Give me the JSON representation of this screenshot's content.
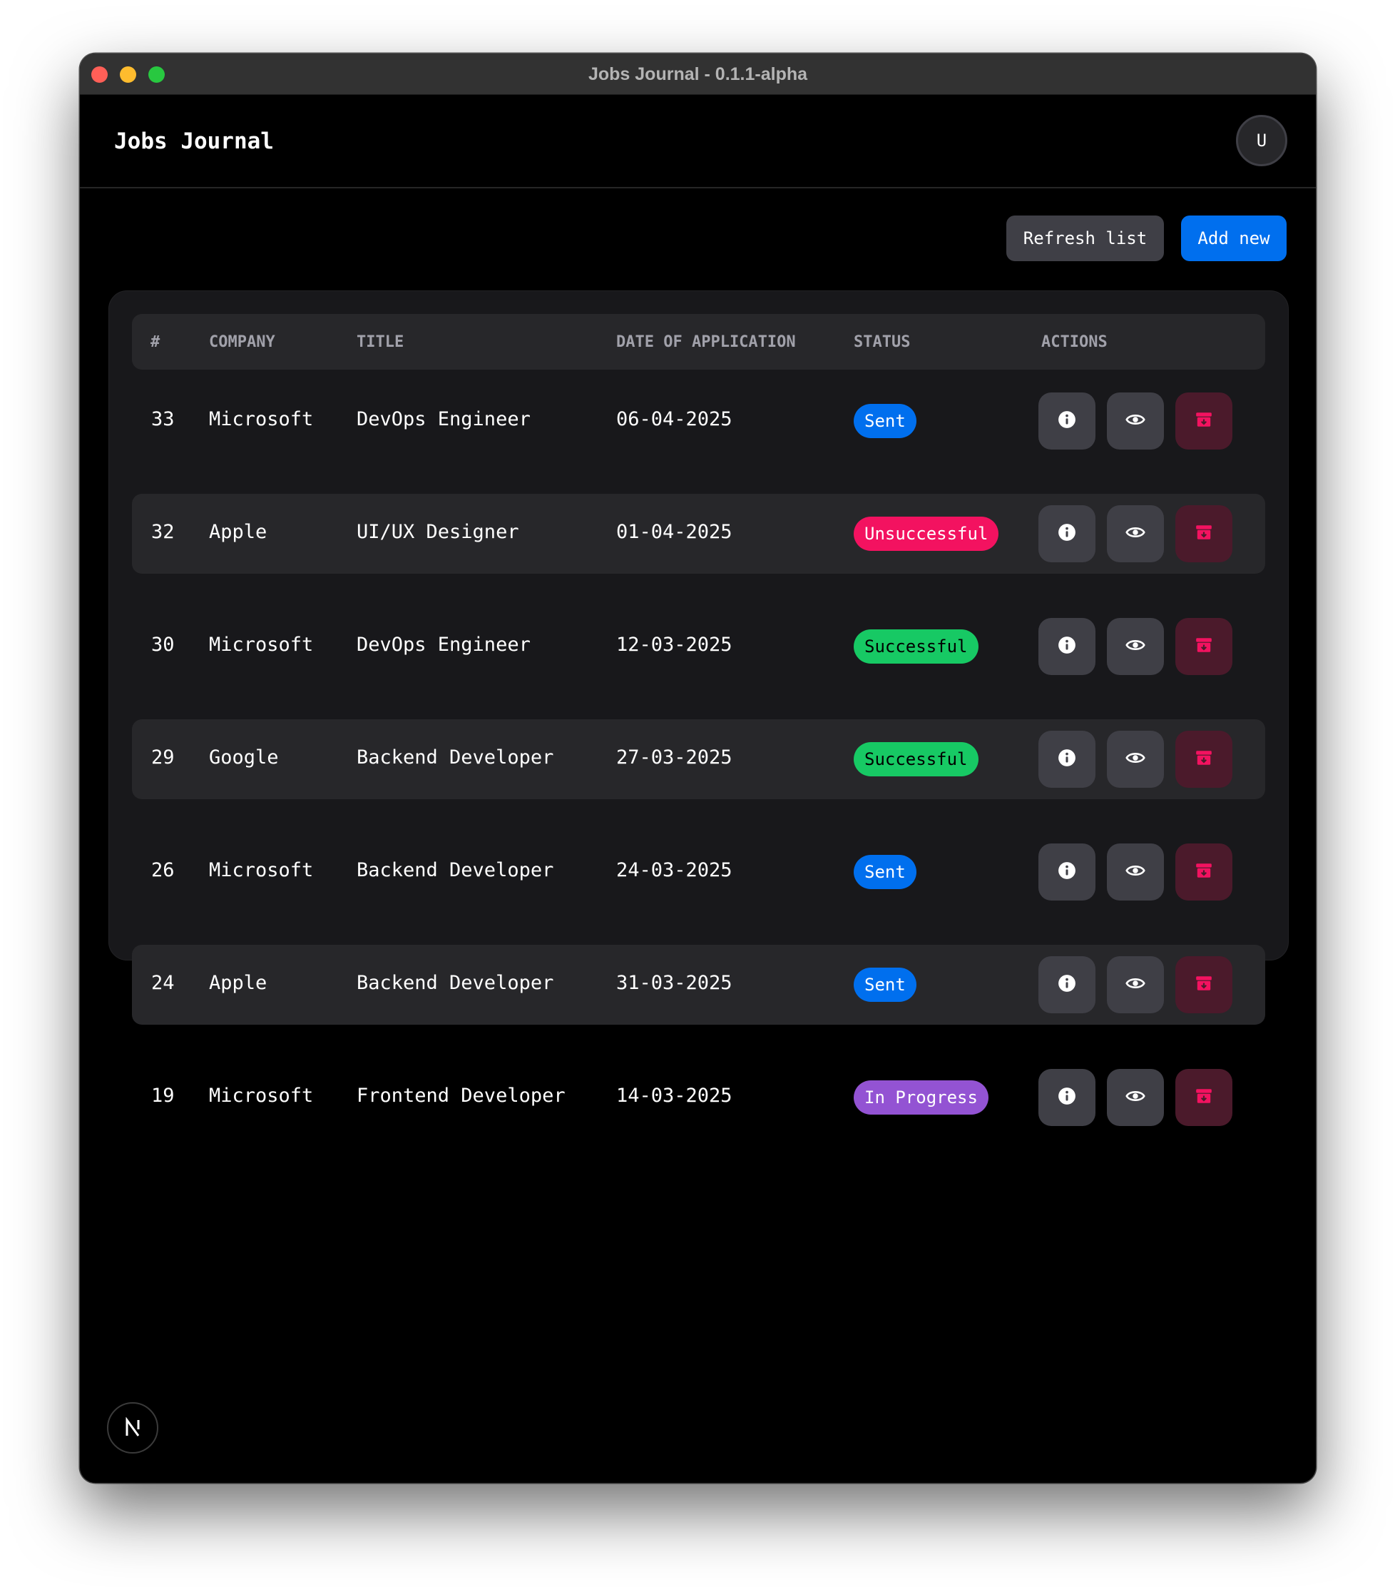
{
  "window": {
    "title": "Jobs Journal - 0.1.1-alpha"
  },
  "header": {
    "brand": "Jobs Journal",
    "avatar_initial": "U"
  },
  "toolbar": {
    "refresh_label": "Refresh list",
    "add_label": "Add new"
  },
  "table": {
    "columns": [
      "#",
      "COMPANY",
      "TITLE",
      "DATE OF APPLICATION",
      "STATUS",
      "ACTIONS"
    ],
    "rows": [
      {
        "id": "33",
        "company": "Microsoft",
        "title": "DevOps Engineer",
        "date": "06-04-2025",
        "status": "Sent"
      },
      {
        "id": "32",
        "company": "Apple",
        "title": "UI/UX Designer",
        "date": "01-04-2025",
        "status": "Unsuccessful"
      },
      {
        "id": "30",
        "company": "Microsoft",
        "title": "DevOps Engineer",
        "date": "12-03-2025",
        "status": "Successful"
      },
      {
        "id": "29",
        "company": "Google",
        "title": "Backend Developer",
        "date": "27-03-2025",
        "status": "Successful"
      },
      {
        "id": "26",
        "company": "Microsoft",
        "title": "Backend Developer",
        "date": "24-03-2025",
        "status": "Sent"
      },
      {
        "id": "24",
        "company": "Apple",
        "title": "Backend Developer",
        "date": "31-03-2025",
        "status": "Sent"
      },
      {
        "id": "19",
        "company": "Microsoft",
        "title": "Frontend Developer",
        "date": "14-03-2025",
        "status": "In Progress"
      }
    ],
    "row_actions": [
      "info-icon",
      "eye-icon",
      "archive-icon"
    ]
  },
  "colors": {
    "sent": "#006fee",
    "unsuccessful": "#f31260",
    "successful": "#17c964",
    "in_progress": "#9353d3",
    "archive_icon": "#f31260"
  },
  "dev_badge": {
    "icon": "nextjs-icon",
    "label": "N"
  }
}
